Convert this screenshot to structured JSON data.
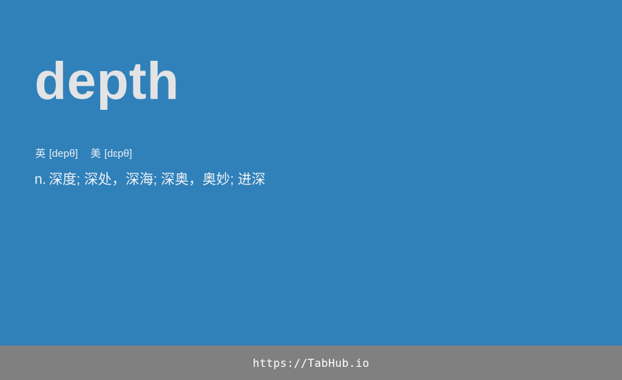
{
  "word": "depth",
  "phonetics": {
    "uk_label": "英",
    "uk_ipa": "[depθ]",
    "us_label": "美",
    "us_ipa": "[dɛpθ]"
  },
  "definition": {
    "pos": "n.",
    "meanings": "深度; 深处，深海; 深奥，奥妙; 进深"
  },
  "footer": {
    "link_text": "https://TabHub.io"
  },
  "colors": {
    "background": "#3081ba",
    "footer_bar": "#808080",
    "word_text": "#e3e3e5"
  }
}
